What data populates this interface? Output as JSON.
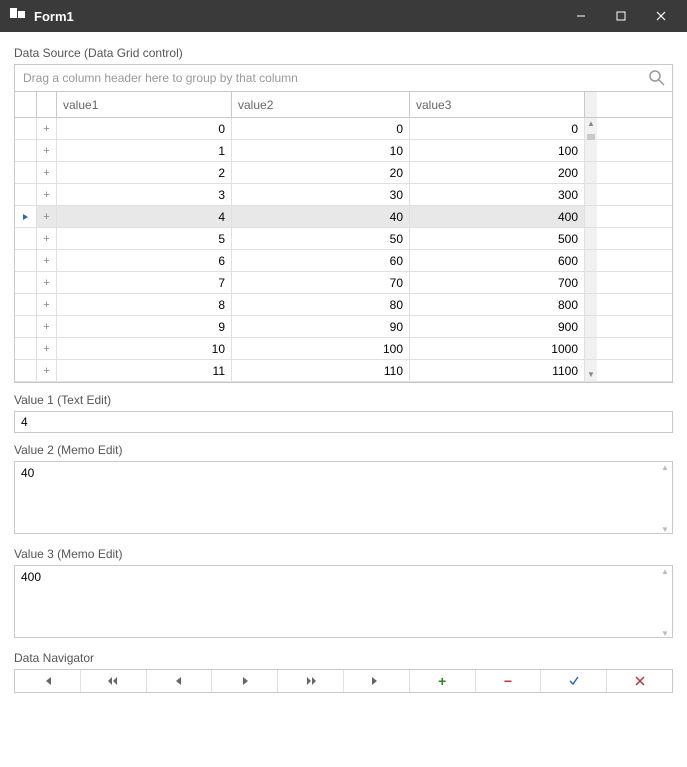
{
  "window": {
    "title": "Form1"
  },
  "grid": {
    "label": "Data Source (Data Grid control)",
    "group_panel": "Drag a column header here to group by that column",
    "columns": {
      "c1": "value1",
      "c2": "value2",
      "c3": "value3"
    },
    "rows": [
      {
        "v1": "0",
        "v2": "0",
        "v3": "0"
      },
      {
        "v1": "1",
        "v2": "10",
        "v3": "100"
      },
      {
        "v1": "2",
        "v2": "20",
        "v3": "200"
      },
      {
        "v1": "3",
        "v2": "30",
        "v3": "300"
      },
      {
        "v1": "4",
        "v2": "40",
        "v3": "400"
      },
      {
        "v1": "5",
        "v2": "50",
        "v3": "500"
      },
      {
        "v1": "6",
        "v2": "60",
        "v3": "600"
      },
      {
        "v1": "7",
        "v2": "70",
        "v3": "700"
      },
      {
        "v1": "8",
        "v2": "80",
        "v3": "800"
      },
      {
        "v1": "9",
        "v2": "90",
        "v3": "900"
      },
      {
        "v1": "10",
        "v2": "100",
        "v3": "1000"
      },
      {
        "v1": "11",
        "v2": "110",
        "v3": "1100"
      }
    ],
    "selected_index": 4
  },
  "editors": {
    "value1": {
      "label": "Value 1 (Text Edit)",
      "value": "4"
    },
    "value2": {
      "label": "Value 2 (Memo Edit)",
      "value": "40"
    },
    "value3": {
      "label": "Value 3 (Memo Edit)",
      "value": "400"
    }
  },
  "navigator": {
    "label": "Data Navigator"
  }
}
